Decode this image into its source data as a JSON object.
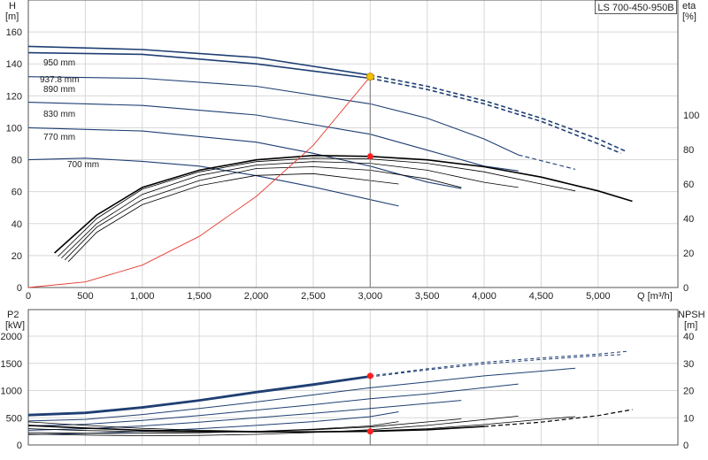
{
  "model_label": "LS 700-450-950B",
  "colors": {
    "head": "#1f3f73",
    "efficiency": "#000000",
    "system_curve": "#e63a2e",
    "duty_point": "#ff1e1e",
    "bep_point": "#f2c200"
  },
  "chart_data": [
    {
      "type": "line",
      "x_unit_label": "Q [m³/h]",
      "y_left_label": [
        "H",
        "[m]"
      ],
      "y_right_label": [
        "eta",
        "[%]"
      ],
      "xlim": [
        0,
        5700
      ],
      "ylim": [
        0,
        180
      ],
      "y_right_lim": [
        0,
        100
      ],
      "x_ticks": [
        0,
        500,
        1000,
        1500,
        2000,
        2500,
        3000,
        3500,
        4000,
        4500,
        5000
      ],
      "x_tick_labels": [
        "0",
        "500",
        "1,000",
        "1,500",
        "2,000",
        "2,500",
        "3,000",
        "3,500",
        "4,000",
        "4,500",
        "5,000"
      ],
      "y_ticks": [
        0,
        20,
        40,
        60,
        80,
        100,
        120,
        140,
        160
      ],
      "y_tick_labels": [
        "0",
        "20",
        "40",
        "60",
        "80",
        "100",
        "120",
        "140",
        "160"
      ],
      "y_right_ticks": [
        0,
        20,
        40,
        60,
        80,
        100
      ],
      "y_right_tick_labels": [
        "0",
        "20",
        "40",
        "60",
        "80",
        "100"
      ],
      "grid": true,
      "head_curves": [
        {
          "name": "950 mm",
          "x": [
            0,
            1000,
            2000,
            3000,
            3500,
            4000,
            4500,
            5000,
            5250
          ],
          "y": [
            151,
            149,
            144,
            133,
            126,
            117,
            106,
            93,
            85
          ],
          "solid_until": 3300
        },
        {
          "name": "937.8 mm",
          "x": [
            0,
            1000,
            2000,
            3000,
            3500,
            4000,
            4500,
            5000,
            5200
          ],
          "y": [
            147,
            146,
            140,
            131,
            124,
            115,
            104,
            90,
            84
          ],
          "solid_until": 3300
        },
        {
          "name": "890 mm",
          "x": [
            0,
            1000,
            2000,
            3000,
            3500,
            4000,
            4300,
            4800
          ],
          "y": [
            132,
            131,
            126,
            115,
            106,
            93,
            83,
            74
          ],
          "solid_until": 4300
        },
        {
          "name": "830 mm",
          "x": [
            0,
            1000,
            2000,
            3000,
            3500,
            4000,
            4300
          ],
          "y": [
            116,
            114,
            108,
            96,
            86,
            76,
            73
          ],
          "solid_until": 4300
        },
        {
          "name": "770 mm",
          "x": [
            0,
            1000,
            2000,
            2500,
            3000,
            3500,
            3800
          ],
          "y": [
            100,
            98,
            91,
            84,
            76,
            66,
            62
          ],
          "solid_until": 3800
        },
        {
          "name": "700 mm",
          "x": [
            0,
            500,
            1000,
            1500,
            2000,
            2500,
            3000,
            3250
          ],
          "y": [
            80,
            81,
            79,
            76,
            70,
            63,
            55,
            51
          ],
          "solid_until": 3250
        }
      ],
      "efficiency_curves": [
        {
          "x": [
            230,
            600,
            1000,
            1500,
            2000,
            2500,
            3000,
            3500,
            4000,
            4500,
            5000,
            5300
          ],
          "y": [
            20,
            42,
            58,
            68,
            74,
            76.5,
            76,
            74,
            70,
            64,
            56,
            50
          ]
        },
        {
          "x": [
            260,
            600,
            1000,
            1500,
            2000,
            2500,
            3000,
            3500,
            4000,
            4500,
            4800
          ],
          "y": [
            18,
            40,
            57,
            67,
            73,
            75,
            74.5,
            72,
            67,
            60,
            56
          ]
        },
        {
          "x": [
            290,
            600,
            1000,
            1500,
            2000,
            2500,
            3000,
            3500,
            4000,
            4300
          ],
          "y": [
            17,
            37,
            54,
            65,
            71,
            73,
            72,
            68,
            61,
            58
          ]
        },
        {
          "x": [
            320,
            600,
            1000,
            1500,
            2000,
            2500,
            3000,
            3500,
            3800
          ],
          "y": [
            16,
            35,
            51,
            62,
            69,
            70,
            68,
            63,
            58
          ]
        },
        {
          "x": [
            350,
            600,
            1000,
            1500,
            2000,
            2500,
            3000,
            3250
          ],
          "y": [
            15,
            32,
            48,
            59,
            65,
            66,
            62,
            60
          ]
        }
      ],
      "system_curve": {
        "x": [
          0,
          500,
          1000,
          1500,
          2000,
          2500,
          3000
        ],
        "y": [
          0,
          3.5,
          14,
          32,
          57,
          89,
          132
        ]
      },
      "duty_point": {
        "x": 3000,
        "y_head": 132,
        "y_efficiency": 76
      },
      "curve_labels": [
        "950 mm",
        "937.8 mm",
        "890 mm",
        "830 mm",
        "770 mm",
        "700 mm"
      ]
    },
    {
      "type": "line",
      "y_left_label": [
        "P2",
        "[kW]"
      ],
      "y_right_label": [
        "NPSH",
        "[m]"
      ],
      "xlim": [
        0,
        5700
      ],
      "ylim": [
        0,
        2000
      ],
      "y_right_lim": [
        0,
        40
      ],
      "y_ticks": [
        0,
        500,
        1000,
        1500,
        2000
      ],
      "y_tick_labels": [
        "0",
        "500",
        "1000",
        "1500",
        "2000"
      ],
      "y_right_ticks": [
        0,
        10,
        20,
        30,
        40
      ],
      "y_right_tick_labels": [
        "0",
        "10",
        "20",
        "30",
        "40"
      ],
      "grid": true,
      "power_curves": [
        {
          "name": "950 mm",
          "x": [
            0,
            500,
            1000,
            1500,
            2000,
            2500,
            3000,
            3500,
            4000,
            4500,
            5000,
            5250
          ],
          "y": [
            560,
            600,
            700,
            830,
            980,
            1120,
            1270,
            1400,
            1520,
            1600,
            1670,
            1720
          ]
        },
        {
          "name": "937.8 mm",
          "x": [
            0,
            500,
            1000,
            1500,
            2000,
            2500,
            3000,
            3500,
            4000,
            4500,
            5000,
            5200
          ],
          "y": [
            540,
            580,
            680,
            810,
            960,
            1100,
            1250,
            1380,
            1490,
            1570,
            1640,
            1660
          ]
        },
        {
          "name": "890 mm",
          "x": [
            0,
            500,
            1000,
            1500,
            2000,
            2500,
            3000,
            3500,
            4000,
            4800
          ],
          "y": [
            440,
            470,
            560,
            670,
            790,
            920,
            1050,
            1160,
            1270,
            1410
          ]
        },
        {
          "name": "830 mm",
          "x": [
            0,
            500,
            1000,
            1500,
            2000,
            2500,
            3000,
            3500,
            4300
          ],
          "y": [
            350,
            380,
            450,
            540,
            640,
            740,
            850,
            940,
            1120
          ]
        },
        {
          "name": "770 mm",
          "x": [
            0,
            500,
            1000,
            1500,
            2000,
            2500,
            3000,
            3800
          ],
          "y": [
            270,
            300,
            350,
            420,
            500,
            580,
            670,
            820
          ]
        },
        {
          "name": "700 mm",
          "x": [
            0,
            500,
            1000,
            1500,
            2000,
            2500,
            3000,
            3250
          ],
          "y": [
            190,
            210,
            250,
            300,
            360,
            430,
            520,
            610
          ]
        }
      ],
      "npsh_curves": [
        {
          "x": [
            0,
            500,
            1000,
            1500,
            2000,
            2500,
            3000,
            3500,
            4000,
            4500,
            5000,
            5300
          ],
          "y": [
            7.2,
            6.2,
            5.4,
            5.0,
            4.8,
            4.8,
            5.0,
            5.6,
            6.8,
            8.4,
            10.8,
            13.0
          ]
        },
        {
          "x": [
            0,
            500,
            1000,
            1500,
            2000,
            2500,
            3000,
            3500,
            4000,
            4500,
            4800
          ],
          "y": [
            8.5,
            7.2,
            6.1,
            5.4,
            5.0,
            4.9,
            5.2,
            6.0,
            7.5,
            9.4,
            10.4
          ]
        },
        {
          "x": [
            0,
            500,
            1000,
            1500,
            2000,
            2500,
            3000,
            3500,
            4300
          ],
          "y": [
            4.0,
            3.6,
            3.4,
            3.5,
            3.9,
            4.6,
            5.6,
            7.2,
            10.6
          ]
        },
        {
          "x": [
            0,
            500,
            1000,
            1500,
            2000,
            2500,
            3000,
            3800
          ],
          "y": [
            6.0,
            5.3,
            4.9,
            4.8,
            5.0,
            5.6,
            6.6,
            9.6
          ]
        },
        {
          "x": [
            0,
            500,
            1000,
            1500,
            2000,
            2500,
            3000,
            3250
          ],
          "y": [
            4.6,
            4.3,
            4.3,
            4.5,
            5.0,
            5.8,
            7.0,
            8.6
          ]
        }
      ],
      "duty_point": {
        "x": 3000,
        "y_power": 1270,
        "y_npsh": 5.0
      }
    }
  ]
}
